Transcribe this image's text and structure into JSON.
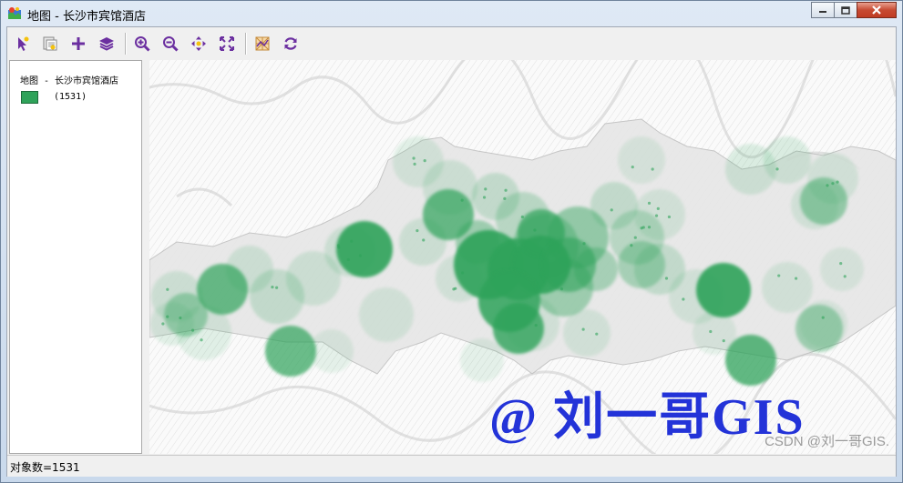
{
  "window": {
    "title": "地图 - 长沙市宾馆酒店",
    "controls": {
      "minimize_icon": "minimize-icon",
      "maximize_icon": "maximize-icon",
      "close_icon": "close-icon"
    }
  },
  "toolbar": {
    "tools": [
      {
        "name": "select-tool",
        "icon": "pointer-icon"
      },
      {
        "name": "info-tool",
        "icon": "info-icon"
      },
      {
        "name": "add-tool",
        "icon": "plus-icon"
      },
      {
        "name": "layers-tool",
        "icon": "layers-icon"
      },
      {
        "name": "zoom-in-tool",
        "icon": "zoom-in-icon"
      },
      {
        "name": "zoom-out-tool",
        "icon": "zoom-out-icon"
      },
      {
        "name": "pan-tool",
        "icon": "pan-icon"
      },
      {
        "name": "full-extent-tool",
        "icon": "full-extent-icon"
      },
      {
        "name": "basemap-tool",
        "icon": "basemap-icon"
      },
      {
        "name": "refresh-tool",
        "icon": "refresh-icon"
      }
    ]
  },
  "legend": {
    "title": "地图 - 长沙市宾馆酒店",
    "items": [
      {
        "count": "(1531)",
        "color": "#2fa35a"
      }
    ]
  },
  "map": {
    "overlay_text": "@ 刘一哥GIS",
    "point_color": "#2fa35a"
  },
  "status": {
    "text": "对象数=1531"
  },
  "watermark": "CSDN @刘一哥GIS."
}
